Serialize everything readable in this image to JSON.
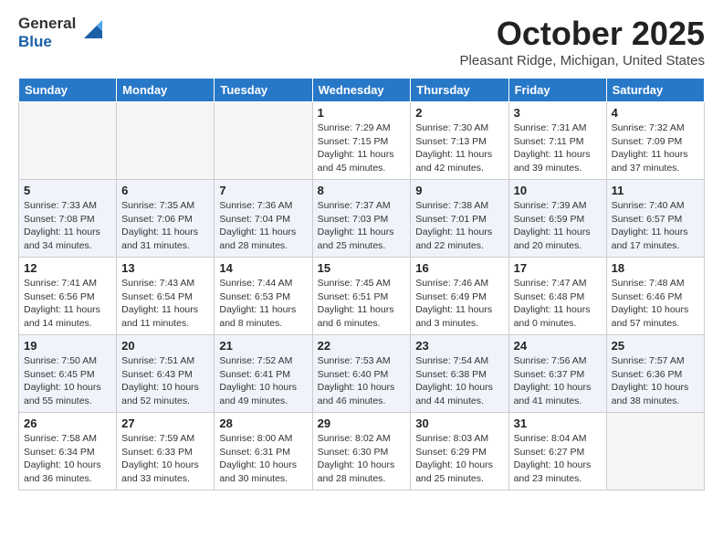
{
  "header": {
    "logo_general": "General",
    "logo_blue": "Blue",
    "month_title": "October 2025",
    "location": "Pleasant Ridge, Michigan, United States"
  },
  "weekdays": [
    "Sunday",
    "Monday",
    "Tuesday",
    "Wednesday",
    "Thursday",
    "Friday",
    "Saturday"
  ],
  "weeks": [
    [
      {
        "day": "",
        "info": ""
      },
      {
        "day": "",
        "info": ""
      },
      {
        "day": "",
        "info": ""
      },
      {
        "day": "1",
        "info": "Sunrise: 7:29 AM\nSunset: 7:15 PM\nDaylight: 11 hours and 45 minutes."
      },
      {
        "day": "2",
        "info": "Sunrise: 7:30 AM\nSunset: 7:13 PM\nDaylight: 11 hours and 42 minutes."
      },
      {
        "day": "3",
        "info": "Sunrise: 7:31 AM\nSunset: 7:11 PM\nDaylight: 11 hours and 39 minutes."
      },
      {
        "day": "4",
        "info": "Sunrise: 7:32 AM\nSunset: 7:09 PM\nDaylight: 11 hours and 37 minutes."
      }
    ],
    [
      {
        "day": "5",
        "info": "Sunrise: 7:33 AM\nSunset: 7:08 PM\nDaylight: 11 hours and 34 minutes."
      },
      {
        "day": "6",
        "info": "Sunrise: 7:35 AM\nSunset: 7:06 PM\nDaylight: 11 hours and 31 minutes."
      },
      {
        "day": "7",
        "info": "Sunrise: 7:36 AM\nSunset: 7:04 PM\nDaylight: 11 hours and 28 minutes."
      },
      {
        "day": "8",
        "info": "Sunrise: 7:37 AM\nSunset: 7:03 PM\nDaylight: 11 hours and 25 minutes."
      },
      {
        "day": "9",
        "info": "Sunrise: 7:38 AM\nSunset: 7:01 PM\nDaylight: 11 hours and 22 minutes."
      },
      {
        "day": "10",
        "info": "Sunrise: 7:39 AM\nSunset: 6:59 PM\nDaylight: 11 hours and 20 minutes."
      },
      {
        "day": "11",
        "info": "Sunrise: 7:40 AM\nSunset: 6:57 PM\nDaylight: 11 hours and 17 minutes."
      }
    ],
    [
      {
        "day": "12",
        "info": "Sunrise: 7:41 AM\nSunset: 6:56 PM\nDaylight: 11 hours and 14 minutes."
      },
      {
        "day": "13",
        "info": "Sunrise: 7:43 AM\nSunset: 6:54 PM\nDaylight: 11 hours and 11 minutes."
      },
      {
        "day": "14",
        "info": "Sunrise: 7:44 AM\nSunset: 6:53 PM\nDaylight: 11 hours and 8 minutes."
      },
      {
        "day": "15",
        "info": "Sunrise: 7:45 AM\nSunset: 6:51 PM\nDaylight: 11 hours and 6 minutes."
      },
      {
        "day": "16",
        "info": "Sunrise: 7:46 AM\nSunset: 6:49 PM\nDaylight: 11 hours and 3 minutes."
      },
      {
        "day": "17",
        "info": "Sunrise: 7:47 AM\nSunset: 6:48 PM\nDaylight: 11 hours and 0 minutes."
      },
      {
        "day": "18",
        "info": "Sunrise: 7:48 AM\nSunset: 6:46 PM\nDaylight: 10 hours and 57 minutes."
      }
    ],
    [
      {
        "day": "19",
        "info": "Sunrise: 7:50 AM\nSunset: 6:45 PM\nDaylight: 10 hours and 55 minutes."
      },
      {
        "day": "20",
        "info": "Sunrise: 7:51 AM\nSunset: 6:43 PM\nDaylight: 10 hours and 52 minutes."
      },
      {
        "day": "21",
        "info": "Sunrise: 7:52 AM\nSunset: 6:41 PM\nDaylight: 10 hours and 49 minutes."
      },
      {
        "day": "22",
        "info": "Sunrise: 7:53 AM\nSunset: 6:40 PM\nDaylight: 10 hours and 46 minutes."
      },
      {
        "day": "23",
        "info": "Sunrise: 7:54 AM\nSunset: 6:38 PM\nDaylight: 10 hours and 44 minutes."
      },
      {
        "day": "24",
        "info": "Sunrise: 7:56 AM\nSunset: 6:37 PM\nDaylight: 10 hours and 41 minutes."
      },
      {
        "day": "25",
        "info": "Sunrise: 7:57 AM\nSunset: 6:36 PM\nDaylight: 10 hours and 38 minutes."
      }
    ],
    [
      {
        "day": "26",
        "info": "Sunrise: 7:58 AM\nSunset: 6:34 PM\nDaylight: 10 hours and 36 minutes."
      },
      {
        "day": "27",
        "info": "Sunrise: 7:59 AM\nSunset: 6:33 PM\nDaylight: 10 hours and 33 minutes."
      },
      {
        "day": "28",
        "info": "Sunrise: 8:00 AM\nSunset: 6:31 PM\nDaylight: 10 hours and 30 minutes."
      },
      {
        "day": "29",
        "info": "Sunrise: 8:02 AM\nSunset: 6:30 PM\nDaylight: 10 hours and 28 minutes."
      },
      {
        "day": "30",
        "info": "Sunrise: 8:03 AM\nSunset: 6:29 PM\nDaylight: 10 hours and 25 minutes."
      },
      {
        "day": "31",
        "info": "Sunrise: 8:04 AM\nSunset: 6:27 PM\nDaylight: 10 hours and 23 minutes."
      },
      {
        "day": "",
        "info": ""
      }
    ]
  ]
}
